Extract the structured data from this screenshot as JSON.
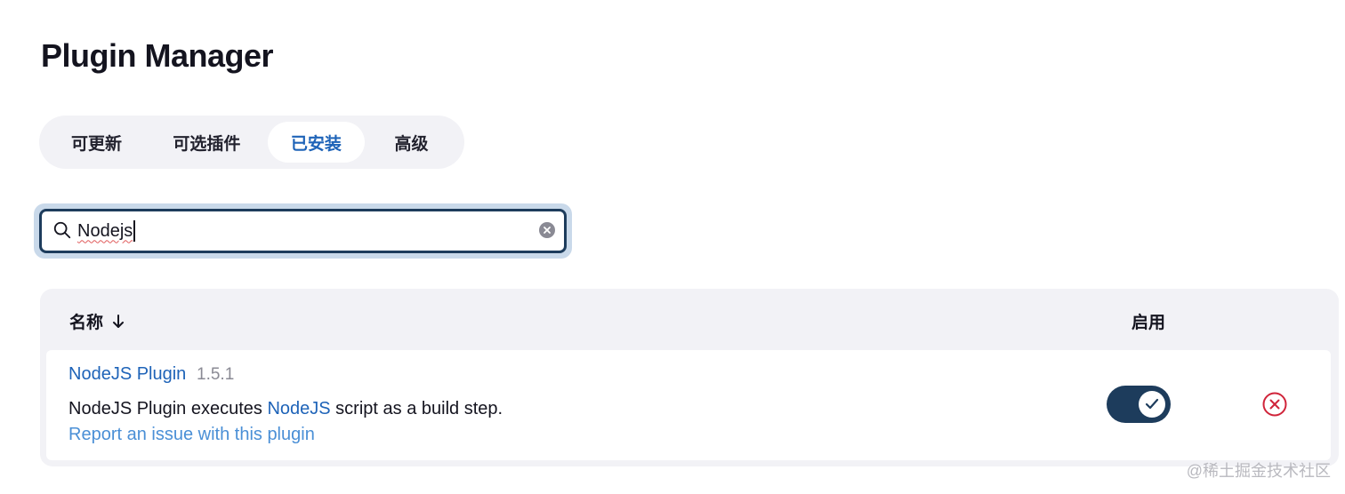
{
  "page": {
    "title": "Plugin Manager"
  },
  "tabs": [
    {
      "label": "可更新",
      "active": false
    },
    {
      "label": "可选插件",
      "active": false
    },
    {
      "label": "已安装",
      "active": true
    },
    {
      "label": "高级",
      "active": false
    }
  ],
  "search": {
    "value": "Nodejs",
    "icon": "search-icon",
    "clear_icon": "clear-icon"
  },
  "table": {
    "columns": {
      "name": "名称",
      "name_sort_icon": "arrow-down-icon",
      "enabled": "启用"
    },
    "rows": [
      {
        "name": "NodeJS Plugin",
        "version": "1.5.1",
        "description_before": "NodeJS Plugin executes ",
        "description_link": "NodeJS",
        "description_after": " script as a build step.",
        "report_link": "Report an issue with this plugin",
        "enabled": true,
        "uninstall_icon": "close-circle-icon"
      }
    ]
  },
  "watermark": "@稀土掘金技术社区",
  "colors": {
    "accent": "#1e63b8",
    "toggle_on": "#1d3c5c",
    "danger": "#d0243a",
    "surface": "#f2f2f6"
  }
}
